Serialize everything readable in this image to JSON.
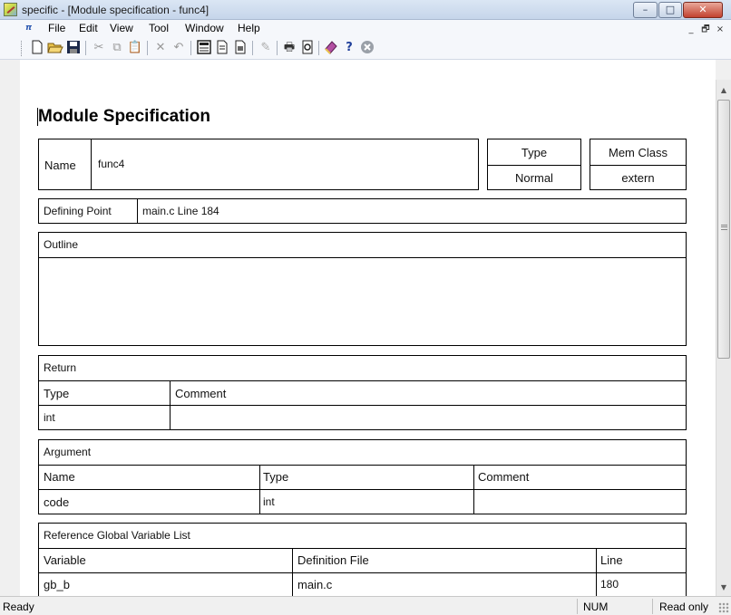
{
  "window": {
    "title": "specific - [Module specification - func4]",
    "caption_buttons": {
      "minimize": "–",
      "maximize": "□",
      "close": "✕"
    }
  },
  "menubar": {
    "items": [
      "File",
      "Edit",
      "View",
      "Tool",
      "Window",
      "Help"
    ],
    "mdi_buttons": {
      "minimize": "_",
      "restore": "🗗",
      "close": "×"
    }
  },
  "toolbar": {
    "icons": [
      "new-file-icon",
      "open-folder-icon",
      "save-icon",
      "cut-icon",
      "copy-icon",
      "paste-icon",
      "delete-icon",
      "undo-icon",
      "spec-view-icon",
      "document-icon",
      "document-alt-icon",
      "pencil-icon",
      "print-icon",
      "print-preview-icon",
      "book-icon",
      "help-icon",
      "stop-icon"
    ]
  },
  "document": {
    "heading": "Module Specification",
    "name_label": "Name",
    "name_value": "func4",
    "type_label": "Type",
    "type_value": "Normal",
    "memclass_label": "Mem Class",
    "memclass_value": "extern",
    "defining_point_label": "Defining Point",
    "defining_point_value": "main.c  Line 184",
    "outline_label": "Outline",
    "return": {
      "label": "Return",
      "headers": [
        "Type",
        "Comment"
      ],
      "rows": [
        [
          "int",
          ""
        ]
      ]
    },
    "argument": {
      "label": "Argument",
      "headers": [
        "Name",
        "Type",
        "Comment"
      ],
      "rows": [
        [
          "code",
          "int",
          ""
        ]
      ]
    },
    "global_vars": {
      "label": "Reference Global Variable List",
      "headers": [
        "Variable",
        "Definition File",
        "Line"
      ],
      "rows": [
        [
          "gb_b",
          "main.c",
          "180"
        ]
      ]
    }
  },
  "statusbar": {
    "status": "Ready",
    "num": "NUM",
    "mode": "Read only"
  }
}
